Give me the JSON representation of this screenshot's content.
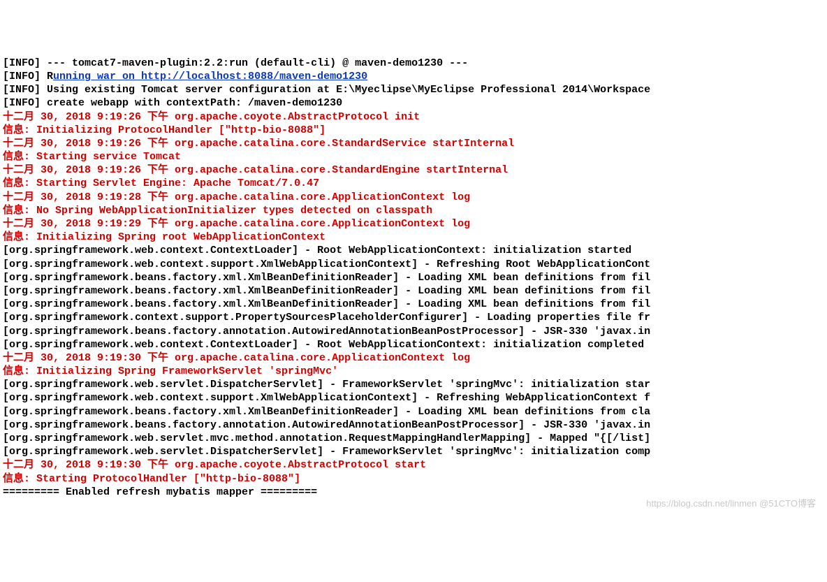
{
  "lines": [
    {
      "parts": [
        {
          "c": "black",
          "t": "[INFO] --- tomcat7-maven-plugin:2.2:run (default-cli) @ maven-demo1230 ---"
        }
      ]
    },
    {
      "parts": [
        {
          "c": "black",
          "t": "[INFO] R"
        },
        {
          "c": "link",
          "t": "unning war on http://localhost:8088/maven-demo1230"
        }
      ]
    },
    {
      "parts": [
        {
          "c": "black",
          "t": "[INFO] Using existing Tomcat server configuration at E:\\Myeclipse\\MyEclipse Professional 2014\\Workspace"
        }
      ]
    },
    {
      "parts": [
        {
          "c": "black",
          "t": "[INFO] create webapp with contextPath: /maven-demo1230"
        }
      ]
    },
    {
      "parts": [
        {
          "c": "red",
          "t": "十二月 30, 2018 9:19:26 下午 org.apache.coyote.AbstractProtocol init"
        }
      ]
    },
    {
      "parts": [
        {
          "c": "red",
          "t": "信息: Initializing ProtocolHandler [\"http-bio-8088\"]"
        }
      ]
    },
    {
      "parts": [
        {
          "c": "red",
          "t": "十二月 30, 2018 9:19:26 下午 org.apache.catalina.core.StandardService startInternal"
        }
      ]
    },
    {
      "parts": [
        {
          "c": "red",
          "t": "信息: Starting service Tomcat"
        }
      ]
    },
    {
      "parts": [
        {
          "c": "red",
          "t": "十二月 30, 2018 9:19:26 下午 org.apache.catalina.core.StandardEngine startInternal"
        }
      ]
    },
    {
      "parts": [
        {
          "c": "red",
          "t": "信息: Starting Servlet Engine: Apache Tomcat/7.0.47"
        }
      ]
    },
    {
      "parts": [
        {
          "c": "red",
          "t": "十二月 30, 2018 9:19:28 下午 org.apache.catalina.core.ApplicationContext log"
        }
      ]
    },
    {
      "parts": [
        {
          "c": "red",
          "t": "信息: No Spring WebApplicationInitializer types detected on classpath"
        }
      ]
    },
    {
      "parts": [
        {
          "c": "red",
          "t": "十二月 30, 2018 9:19:29 下午 org.apache.catalina.core.ApplicationContext log"
        }
      ]
    },
    {
      "parts": [
        {
          "c": "red",
          "t": "信息: Initializing Spring root WebApplicationContext"
        }
      ]
    },
    {
      "parts": [
        {
          "c": "black",
          "t": "[org.springframework.web.context.ContextLoader] - Root WebApplicationContext: initialization started"
        }
      ]
    },
    {
      "parts": [
        {
          "c": "black",
          "t": "[org.springframework.web.context.support.XmlWebApplicationContext] - Refreshing Root WebApplicationCont"
        }
      ]
    },
    {
      "parts": [
        {
          "c": "black",
          "t": "[org.springframework.beans.factory.xml.XmlBeanDefinitionReader] - Loading XML bean definitions from fil"
        }
      ]
    },
    {
      "parts": [
        {
          "c": "black",
          "t": "[org.springframework.beans.factory.xml.XmlBeanDefinitionReader] - Loading XML bean definitions from fil"
        }
      ]
    },
    {
      "parts": [
        {
          "c": "black",
          "t": "[org.springframework.beans.factory.xml.XmlBeanDefinitionReader] - Loading XML bean definitions from fil"
        }
      ]
    },
    {
      "parts": [
        {
          "c": "black",
          "t": "[org.springframework.context.support.PropertySourcesPlaceholderConfigurer] - Loading properties file fr"
        }
      ]
    },
    {
      "parts": [
        {
          "c": "black",
          "t": "[org.springframework.beans.factory.annotation.AutowiredAnnotationBeanPostProcessor] - JSR-330 'javax.in"
        }
      ]
    },
    {
      "parts": [
        {
          "c": "black",
          "t": "[org.springframework.web.context.ContextLoader] - Root WebApplicationContext: initialization completed "
        }
      ]
    },
    {
      "parts": [
        {
          "c": "red",
          "t": "十二月 30, 2018 9:19:30 下午 org.apache.catalina.core.ApplicationContext log"
        }
      ]
    },
    {
      "parts": [
        {
          "c": "red",
          "t": "信息: Initializing Spring FrameworkServlet 'springMvc'"
        }
      ]
    },
    {
      "parts": [
        {
          "c": "black",
          "t": "[org.springframework.web.servlet.DispatcherServlet] - FrameworkServlet 'springMvc': initialization star"
        }
      ]
    },
    {
      "parts": [
        {
          "c": "black",
          "t": "[org.springframework.web.context.support.XmlWebApplicationContext] - Refreshing WebApplicationContext f"
        }
      ]
    },
    {
      "parts": [
        {
          "c": "black",
          "t": "[org.springframework.beans.factory.xml.XmlBeanDefinitionReader] - Loading XML bean definitions from cla"
        }
      ]
    },
    {
      "parts": [
        {
          "c": "black",
          "t": "[org.springframework.beans.factory.annotation.AutowiredAnnotationBeanPostProcessor] - JSR-330 'javax.in"
        }
      ]
    },
    {
      "parts": [
        {
          "c": "black",
          "t": "[org.springframework.web.servlet.mvc.method.annotation.RequestMappingHandlerMapping] - Mapped \"{[/list]"
        }
      ]
    },
    {
      "parts": [
        {
          "c": "black",
          "t": "[org.springframework.web.servlet.DispatcherServlet] - FrameworkServlet 'springMvc': initialization comp"
        }
      ]
    },
    {
      "parts": [
        {
          "c": "red",
          "t": "十二月 30, 2018 9:19:30 下午 org.apache.coyote.AbstractProtocol start"
        }
      ]
    },
    {
      "parts": [
        {
          "c": "red",
          "t": "信息: Starting ProtocolHandler [\"http-bio-8088\"]"
        }
      ]
    },
    {
      "parts": [
        {
          "c": "black",
          "t": "========= Enabled refresh mybatis mapper ========="
        }
      ]
    }
  ],
  "watermark": "https://blog.csdn.net/linmen @51CTO博客"
}
